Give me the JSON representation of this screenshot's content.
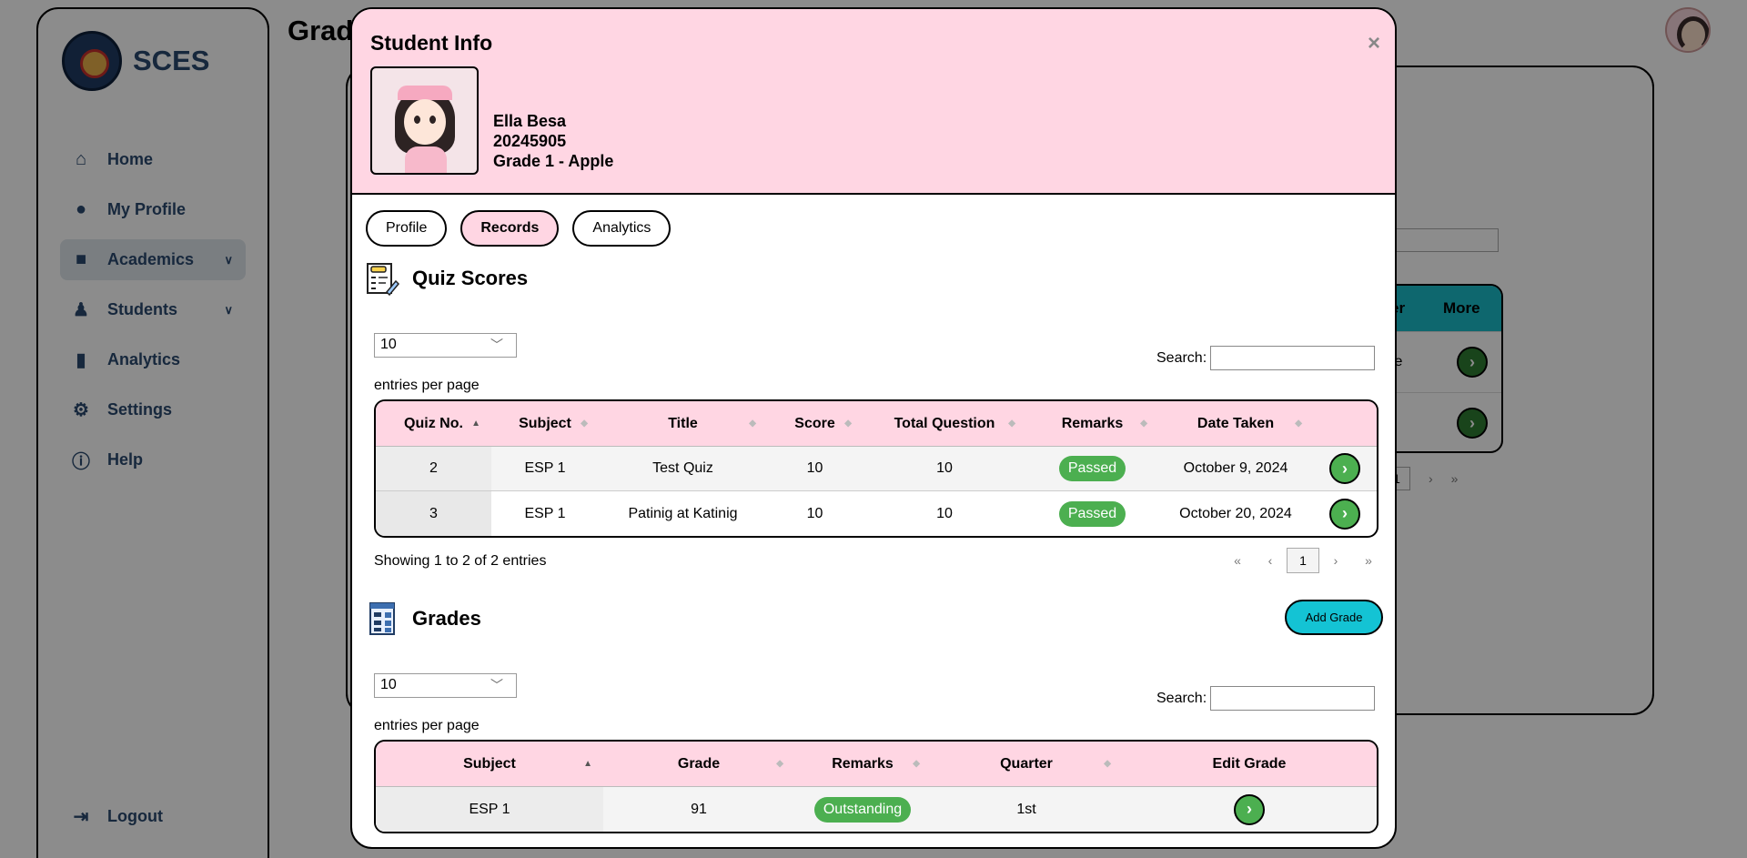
{
  "app": {
    "brand": "SCES",
    "page_title": "Grad",
    "nav": [
      {
        "label": "Home",
        "icon": "home-icon"
      },
      {
        "label": "My Profile",
        "icon": "user-icon"
      },
      {
        "label": "Academics",
        "icon": "briefcase-icon"
      },
      {
        "label": "Students",
        "icon": "student-icon"
      },
      {
        "label": "Analytics",
        "icon": "chart-icon"
      },
      {
        "label": "Settings",
        "icon": "gear-icon"
      },
      {
        "label": "Help",
        "icon": "info-icon"
      }
    ],
    "logout": "Logout",
    "bg_table": {
      "headers": [
        "er",
        "More"
      ],
      "rows": [
        "ale",
        "le"
      ],
      "page": "1"
    }
  },
  "modal": {
    "title": "Student Info",
    "close": "×",
    "student": {
      "name": "Ella Besa",
      "id": "20245905",
      "section": "Grade 1 - Apple"
    },
    "tabs": [
      "Profile",
      "Records",
      "Analytics"
    ],
    "active_tab": "Records",
    "quiz": {
      "heading": "Quiz Scores",
      "length": "10",
      "entries_label": "entries per page",
      "search_label": "Search:",
      "columns": [
        "Quiz No.",
        "Subject",
        "Title",
        "Score",
        "Total Question",
        "Remarks",
        "Date Taken",
        ""
      ],
      "rows": [
        {
          "no": "2",
          "subject": "ESP 1",
          "title": "Test Quiz",
          "score": "10",
          "total": "10",
          "remarks": "Passed",
          "date": "October 9, 2024"
        },
        {
          "no": "3",
          "subject": "ESP 1",
          "title": "Patinig at Katinig",
          "score": "10",
          "total": "10",
          "remarks": "Passed",
          "date": "October 20, 2024"
        }
      ],
      "showing": "Showing 1 to 2 of 2 entries",
      "pager": {
        "first": "«",
        "prev": "‹",
        "page": "1",
        "next": "›",
        "last": "»"
      }
    },
    "grades": {
      "heading": "Grades",
      "add_button": "Add Grade",
      "length": "10",
      "entries_label": "entries per page",
      "search_label": "Search:",
      "columns": [
        "Subject",
        "Grade",
        "Remarks",
        "Quarter",
        "Edit Grade"
      ],
      "rows": [
        {
          "subject": "ESP 1",
          "grade": "91",
          "remarks": "Outstanding",
          "quarter": "1st"
        }
      ]
    }
  },
  "colors": {
    "header_pink": "#ffd6e3",
    "success_green": "#4caf50",
    "accent_cyan": "#14c3d4",
    "nav_text": "#2b4a6f"
  }
}
